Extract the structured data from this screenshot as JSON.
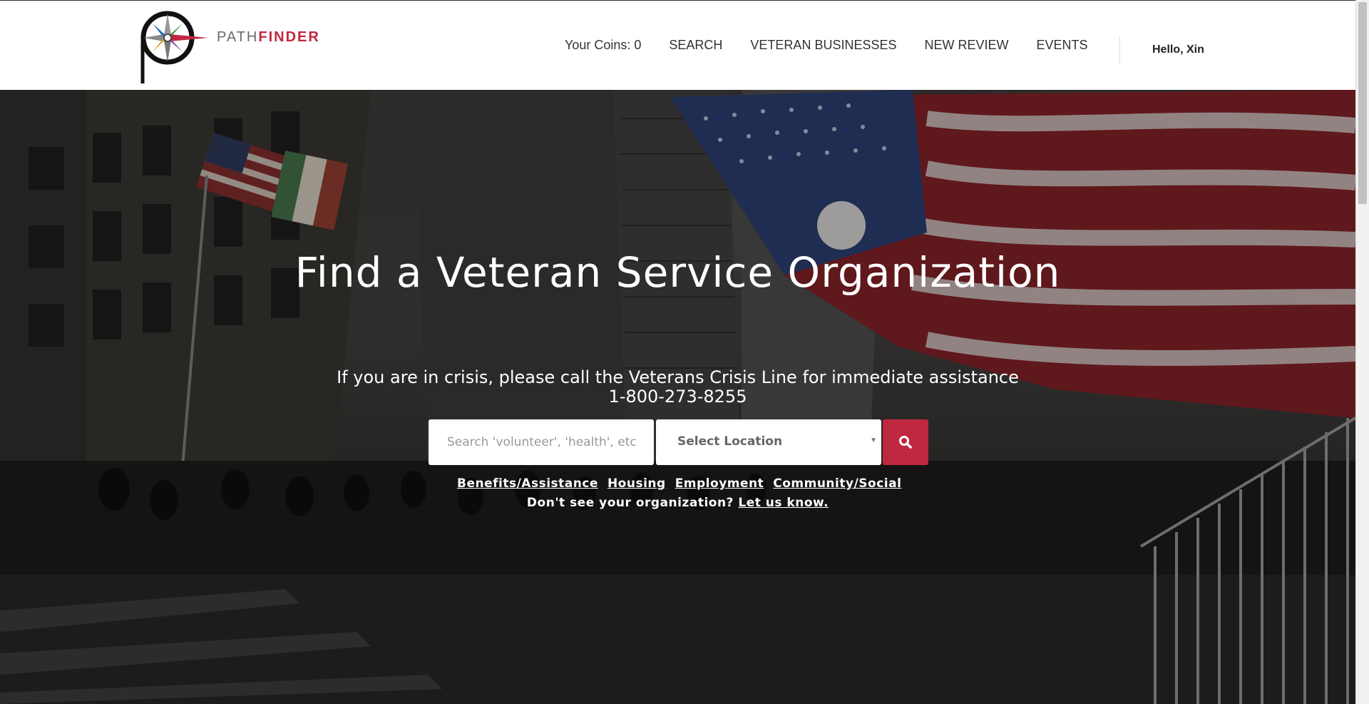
{
  "brand": {
    "name_part1": "PATH",
    "name_part2": "FINDER",
    "accent": "#c0283f"
  },
  "nav": {
    "coins": "Your Coins: 0",
    "items": [
      "SEARCH",
      "VETERAN BUSINESSES",
      "NEW REVIEW",
      "EVENTS"
    ],
    "greeting": "Hello, Xin"
  },
  "hero": {
    "title": "Find a Veteran Service Organization",
    "crisis_line1": "If you are in crisis, please call the Veterans Crisis Line for immediate assistance",
    "crisis_phone": "1-800-273-8255",
    "search_placeholder": "Search 'volunteer', 'health', etc",
    "location_label": "Select Location",
    "search_icon": "search-icon",
    "quick_links": [
      "Benefits/Assistance",
      "Housing",
      "Employment",
      "Community/Social"
    ],
    "dont_see_text": "Don't see your organization?",
    "dont_see_link": "Let us know."
  }
}
